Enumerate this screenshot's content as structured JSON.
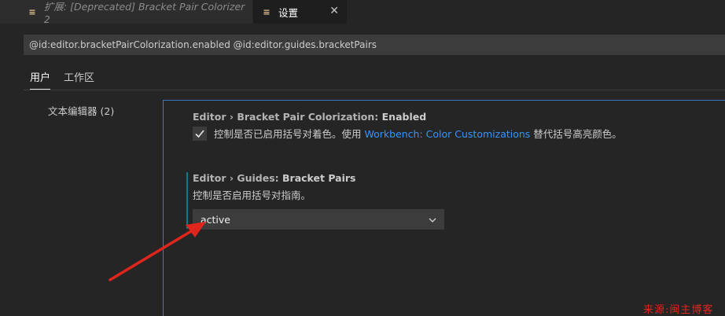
{
  "tabs": [
    {
      "label": "扩展: [Deprecated] Bracket Pair Colorizer 2",
      "icon": "≡"
    },
    {
      "label": "设置",
      "icon": "≡",
      "close": "✕"
    }
  ],
  "search": {
    "value": "@id:editor.bracketPairColorization.enabled @id:editor.guides.bracketPairs"
  },
  "scope_tabs": {
    "user": "用户",
    "workspace": "工作区"
  },
  "toc": {
    "label": "文本编辑器",
    "count": "(2)"
  },
  "settings": {
    "bracket_colorization": {
      "category": "Editor › Bracket Pair Colorization: ",
      "name": "Enabled",
      "checked": true,
      "desc_before": "控制是否已启用括号对着色。使用 ",
      "desc_link": "Workbench: Color Customizations",
      "desc_after": " 替代括号高亮颜色。"
    },
    "bracket_guides": {
      "category": "Editor › Guides: ",
      "name": "Bracket Pairs",
      "desc": "控制是否启用括号对指南。",
      "value": "active"
    }
  },
  "watermark": "来源:闽主博客",
  "colors": {
    "accent": "#3e79c7",
    "link": "#3794ff",
    "annotation": "#e0251c"
  }
}
